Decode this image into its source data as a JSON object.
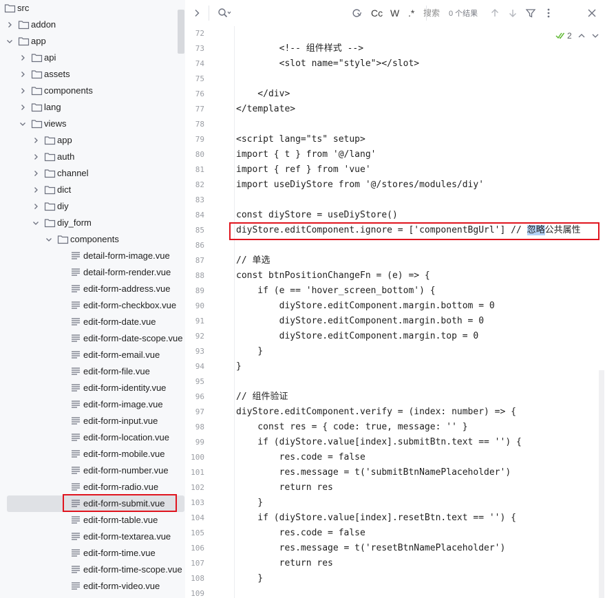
{
  "file_tree": {
    "items": [
      {
        "label": "src",
        "depth": 0,
        "kind": "folder",
        "expanded": true
      },
      {
        "label": "addon",
        "depth": 0,
        "kind": "folder",
        "expanded": false
      },
      {
        "label": "app",
        "depth": 0,
        "kind": "folder",
        "expanded": true
      },
      {
        "label": "api",
        "depth": 1,
        "kind": "folder",
        "expanded": false
      },
      {
        "label": "assets",
        "depth": 1,
        "kind": "folder",
        "expanded": false
      },
      {
        "label": "components",
        "depth": 1,
        "kind": "folder",
        "expanded": false
      },
      {
        "label": "lang",
        "depth": 1,
        "kind": "folder",
        "expanded": false
      },
      {
        "label": "views",
        "depth": 1,
        "kind": "folder",
        "expanded": true
      },
      {
        "label": "app",
        "depth": 2,
        "kind": "folder",
        "expanded": false
      },
      {
        "label": "auth",
        "depth": 2,
        "kind": "folder",
        "expanded": false
      },
      {
        "label": "channel",
        "depth": 2,
        "kind": "folder",
        "expanded": false
      },
      {
        "label": "dict",
        "depth": 2,
        "kind": "folder",
        "expanded": false
      },
      {
        "label": "diy",
        "depth": 2,
        "kind": "folder",
        "expanded": false
      },
      {
        "label": "diy_form",
        "depth": 2,
        "kind": "folder",
        "expanded": true
      },
      {
        "label": "components",
        "depth": 3,
        "kind": "folder",
        "expanded": true
      },
      {
        "label": "detail-form-image.vue",
        "depth": 4,
        "kind": "file"
      },
      {
        "label": "detail-form-render.vue",
        "depth": 4,
        "kind": "file"
      },
      {
        "label": "edit-form-address.vue",
        "depth": 4,
        "kind": "file"
      },
      {
        "label": "edit-form-checkbox.vue",
        "depth": 4,
        "kind": "file"
      },
      {
        "label": "edit-form-date.vue",
        "depth": 4,
        "kind": "file"
      },
      {
        "label": "edit-form-date-scope.vue",
        "depth": 4,
        "kind": "file"
      },
      {
        "label": "edit-form-email.vue",
        "depth": 4,
        "kind": "file"
      },
      {
        "label": "edit-form-file.vue",
        "depth": 4,
        "kind": "file"
      },
      {
        "label": "edit-form-identity.vue",
        "depth": 4,
        "kind": "file"
      },
      {
        "label": "edit-form-image.vue",
        "depth": 4,
        "kind": "file"
      },
      {
        "label": "edit-form-input.vue",
        "depth": 4,
        "kind": "file"
      },
      {
        "label": "edit-form-location.vue",
        "depth": 4,
        "kind": "file"
      },
      {
        "label": "edit-form-mobile.vue",
        "depth": 4,
        "kind": "file"
      },
      {
        "label": "edit-form-number.vue",
        "depth": 4,
        "kind": "file"
      },
      {
        "label": "edit-form-radio.vue",
        "depth": 4,
        "kind": "file"
      },
      {
        "label": "edit-form-submit.vue",
        "depth": 4,
        "kind": "file",
        "selected": true,
        "highlighted": true
      },
      {
        "label": "edit-form-table.vue",
        "depth": 4,
        "kind": "file"
      },
      {
        "label": "edit-form-textarea.vue",
        "depth": 4,
        "kind": "file"
      },
      {
        "label": "edit-form-time.vue",
        "depth": 4,
        "kind": "file"
      },
      {
        "label": "edit-form-time-scope.vue",
        "depth": 4,
        "kind": "file"
      },
      {
        "label": "edit-form-video.vue",
        "depth": 4,
        "kind": "file"
      }
    ]
  },
  "find_bar": {
    "placeholder": "搜索",
    "match_case_label": "Cc",
    "whole_word_label": "W",
    "regex_label": ".*",
    "results": "0 个结果"
  },
  "editor": {
    "check_count": "2",
    "accent": "#e0141e",
    "lines": [
      {
        "n": "72",
        "t": ""
      },
      {
        "n": "73",
        "t": "        <!-- 组件样式 -->"
      },
      {
        "n": "74",
        "t": "        <slot name=\"style\"></slot>"
      },
      {
        "n": "75",
        "t": ""
      },
      {
        "n": "76",
        "t": "    </div>"
      },
      {
        "n": "77",
        "t": "</template>"
      },
      {
        "n": "78",
        "t": ""
      },
      {
        "n": "79",
        "t": "<script lang=\"ts\" setup>"
      },
      {
        "n": "80",
        "t": "import { t } from '@/lang'"
      },
      {
        "n": "81",
        "t": "import { ref } from 'vue'"
      },
      {
        "n": "82",
        "t": "import useDiyStore from '@/stores/modules/diy'"
      },
      {
        "n": "83",
        "t": ""
      },
      {
        "n": "84",
        "t": "const diyStore = useDiyStore()"
      },
      {
        "n": "85",
        "t": "diyStore.editComponent.ignore = ['componentBgUrl'] // ",
        "sel": "忽略",
        "after": "公共属性",
        "highlighted": true
      },
      {
        "n": "86",
        "t": ""
      },
      {
        "n": "87",
        "t": "// 单选"
      },
      {
        "n": "88",
        "t": "const btnPositionChangeFn = (e) => {"
      },
      {
        "n": "89",
        "t": "    if (e == 'hover_screen_bottom') {"
      },
      {
        "n": "90",
        "t": "        diyStore.editComponent.margin.bottom = 0"
      },
      {
        "n": "91",
        "t": "        diyStore.editComponent.margin.both = 0"
      },
      {
        "n": "92",
        "t": "        diyStore.editComponent.margin.top = 0"
      },
      {
        "n": "93",
        "t": "    }"
      },
      {
        "n": "94",
        "t": "}"
      },
      {
        "n": "95",
        "t": ""
      },
      {
        "n": "96",
        "t": "// 组件验证"
      },
      {
        "n": "97",
        "t": "diyStore.editComponent.verify = (index: number) => {"
      },
      {
        "n": "98",
        "t": "    const res = { code: true, message: '' }"
      },
      {
        "n": "99",
        "t": "    if (diyStore.value[index].submitBtn.text == '') {"
      },
      {
        "n": "100",
        "t": "        res.code = false"
      },
      {
        "n": "101",
        "t": "        res.message = t('submitBtnNamePlaceholder')"
      },
      {
        "n": "102",
        "t": "        return res"
      },
      {
        "n": "103",
        "t": "    }"
      },
      {
        "n": "104",
        "t": "    if (diyStore.value[index].resetBtn.text == '') {"
      },
      {
        "n": "105",
        "t": "        res.code = false"
      },
      {
        "n": "106",
        "t": "        res.message = t('resetBtnNamePlaceholder')"
      },
      {
        "n": "107",
        "t": "        return res"
      },
      {
        "n": "108",
        "t": "    }"
      },
      {
        "n": "109",
        "t": ""
      }
    ]
  }
}
